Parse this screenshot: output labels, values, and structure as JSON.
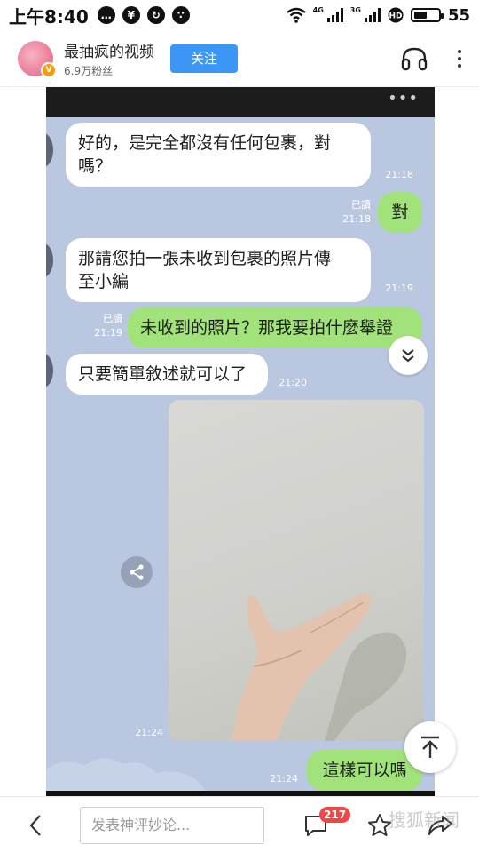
{
  "status_bar": {
    "time": "上午8:40",
    "battery": "55",
    "battery_level": 0.55,
    "net_1": "4G",
    "net_2": "3G"
  },
  "header": {
    "channel_name": "最抽疯的视频",
    "fans": "6.9万粉丝",
    "follow_label": "关注",
    "avatar_badge": "V"
  },
  "chat": {
    "messages": [
      {
        "side": "in",
        "text": "好的，是完全都沒有任何包裹，對\n嗎？",
        "time": "21:18"
      },
      {
        "side": "out",
        "text": "對",
        "time": "21:18",
        "read": "已讀"
      },
      {
        "side": "in",
        "text": "那請您拍一張未收到包裹的照片傳\n至小編",
        "time": "21:19"
      },
      {
        "side": "out",
        "text": "未收到的照片？那我要拍什麼舉證",
        "time": "21:19",
        "read": "已讀"
      },
      {
        "side": "in",
        "text": "只要簡單敘述就可以了",
        "time": "21:20"
      },
      {
        "side": "out",
        "text": "這樣可以嗎",
        "time": "21:24"
      }
    ],
    "photo_time": "21:24",
    "more_dots": "•••"
  },
  "bottom_bar": {
    "comment_placeholder": "发表神评妙论...",
    "comment_count": "217",
    "watermark_text": "搜狐新闻"
  },
  "colors": {
    "follow": "#3b96f5",
    "chat_bg": "#b9c7e1",
    "bubble_out": "#a1e37a",
    "badge": "#f04848"
  },
  "icons": [
    "headphones-icon",
    "more-vertical-icon",
    "back-arrow-icon",
    "comment-icon",
    "star-icon",
    "share-icon",
    "back-to-top-icon",
    "chevron-double-down-icon"
  ]
}
